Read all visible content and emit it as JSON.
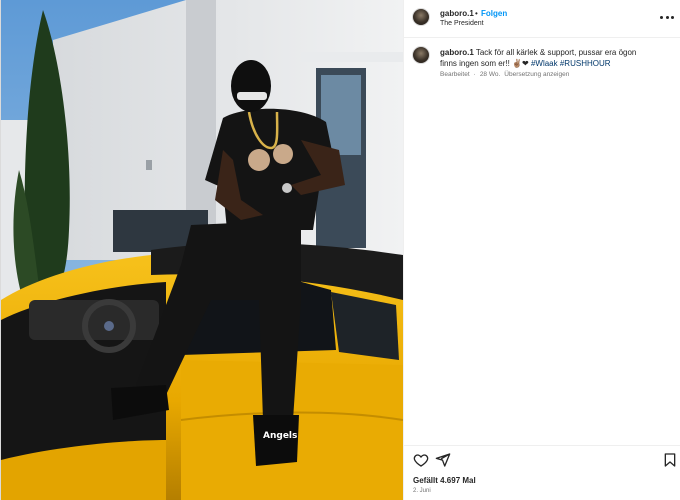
{
  "post": {
    "username": "gaboro.1",
    "follow_label": "Folgen",
    "subtitle": "The President",
    "caption_user": "gaboro.1",
    "caption_text": "Tack för all kärlek & support, pussar era ögon finns ingen som er!! ✌🏽❤",
    "hashtags": [
      "#Wlaak",
      "#RUSHHOUR"
    ],
    "edited_label": "Bearbeitet",
    "time_ago": "28 Wo.",
    "translate_label": "Übersetzung anzeigen",
    "likes_text": "Gefällt 4.697 Mal",
    "date": "2. Juni"
  },
  "icons": {
    "header_avatar": "avatar-icon",
    "more": "more-options-icon",
    "like": "heart-icon",
    "share": "send-icon",
    "save": "bookmark-icon"
  },
  "colors": {
    "link_blue": "#0095f6",
    "hashtag": "#00376b",
    "secondary_text": "#737373",
    "car_yellow": "#f2b705"
  },
  "media": {
    "alt_text_visible": "",
    "car_sticker_text": "Angels"
  }
}
